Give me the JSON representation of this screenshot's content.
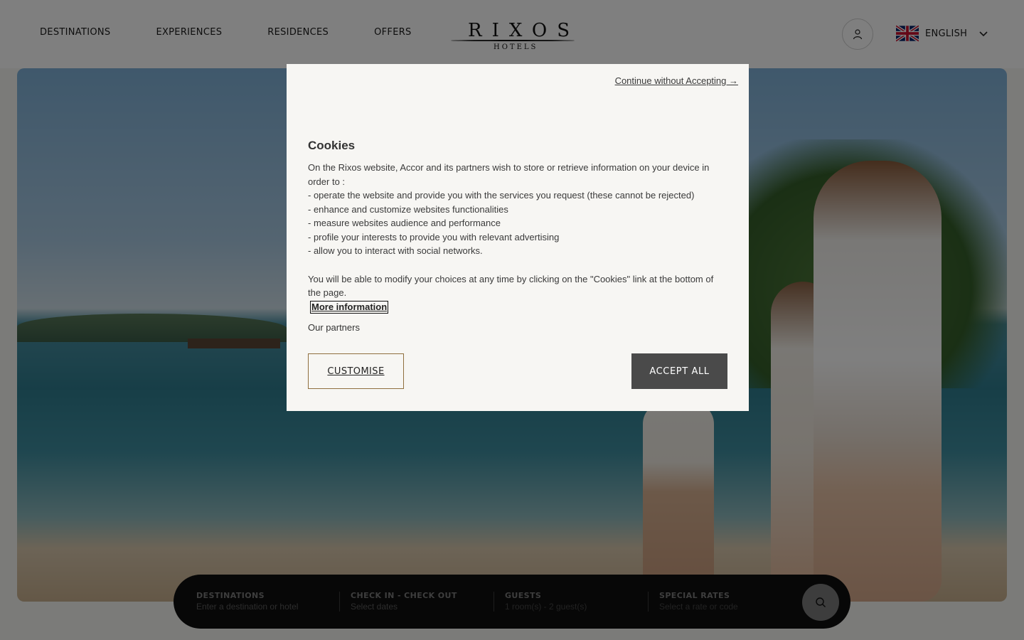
{
  "header": {
    "nav": [
      "DESTINATIONS",
      "EXPERIENCES",
      "RESIDENCES",
      "OFFERS"
    ],
    "logo": {
      "word": "RIXOS",
      "sub": "HOTELS"
    },
    "account_icon": "user-icon",
    "language": {
      "flag_icon": "uk-flag-icon",
      "label": "ENGLISH",
      "chevron_icon": "chevron-down-icon"
    }
  },
  "cookie_modal": {
    "continue_link": "Continue without Accepting →",
    "title": "Cookies",
    "intro": "On the Rixos website, Accor and its partners wish to store or retrieve information on your device in order to :",
    "items": [
      "- operate the website and provide you with the services you request (these cannot be rejected)",
      "- enhance and customize websites functionalities",
      "- measure websites audience and performance",
      "- profile your interests to provide you with relevant advertising",
      "- allow you to interact with social networks."
    ],
    "modify_note": "You will be able to modify your choices at any time by clicking on the \"Cookies\" link at the bottom of the page.",
    "more_info": "More information",
    "partners": "Our partners",
    "customise_label": "CUSTOMISE",
    "accept_label": "ACCEPT ALL"
  },
  "search_bar": {
    "fields": [
      {
        "label": "DESTINATIONS",
        "value": "Enter a destination or hotel"
      },
      {
        "label": "CHECK IN - CHECK OUT",
        "value": "Select dates"
      },
      {
        "label": "GUESTS",
        "value": "1 room(s) - 2 guest(s)"
      },
      {
        "label": "SPECIAL RATES",
        "value": "Select a rate or code"
      }
    ],
    "search_icon": "search-icon"
  },
  "colors": {
    "accept_button": "#4a4a4a",
    "customise_border": "#8f6f3e",
    "overlay": "rgba(0,0,0,0.5)"
  }
}
